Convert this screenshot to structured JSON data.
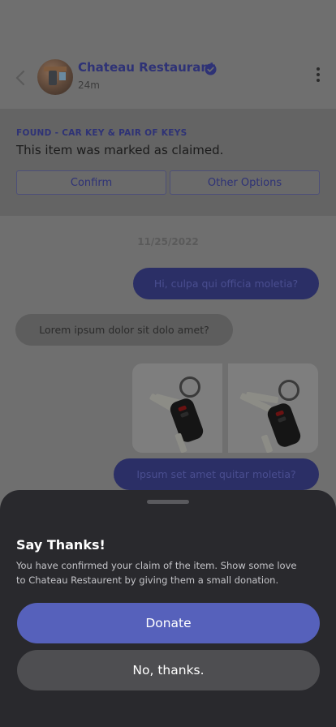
{
  "header": {
    "restaurant_name": "Chateau Restaurant",
    "time_ago": "24m",
    "icons": [
      "back-chevron-icon",
      "verified-check-icon",
      "more-vertical-icon"
    ]
  },
  "claim": {
    "tag": "FOUND - CAR KEY & PAIR OF KEYS",
    "message": "This item was marked as claimed.",
    "confirm_label": "Confirm",
    "other_label": "Other Options"
  },
  "chat": {
    "date": "11/25/2022",
    "messages": [
      {
        "direction": "out",
        "text": "Hi, culpa qui officia moletia?"
      },
      {
        "direction": "in",
        "text": "Lorem ipsum dolor sit dolo amet?"
      },
      {
        "direction": "out",
        "text": "Ipsum set amet quitar moletia?"
      }
    ]
  },
  "sheet": {
    "title": "Say Thanks!",
    "text": "You have confirmed your claim of the item. Show some love\n to Chateau Restaurent by giving them a small donation.",
    "donate_label": "Donate",
    "decline_label": "No, thanks."
  },
  "colors": {
    "accent": "#5661bb",
    "sheet_bg": "#29292d",
    "decline_bg": "#4e4e51"
  }
}
